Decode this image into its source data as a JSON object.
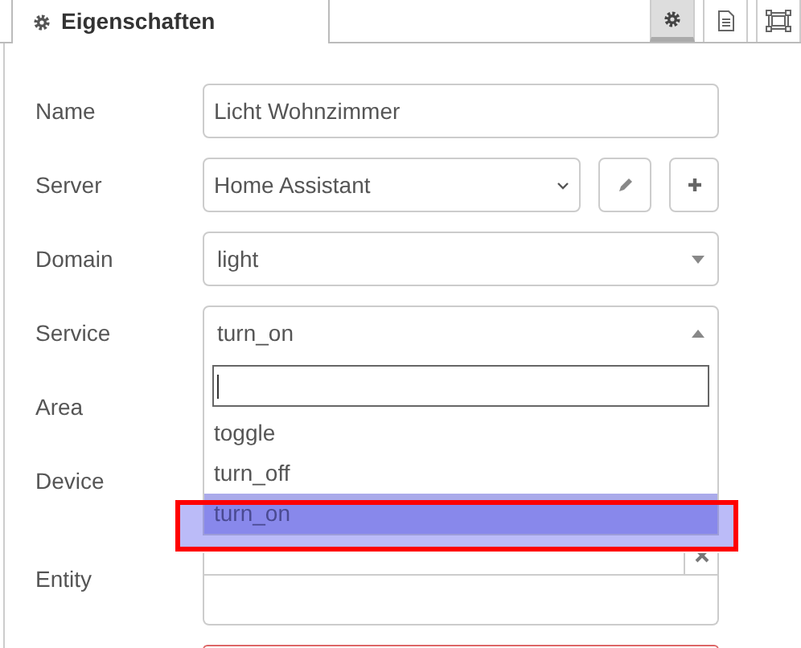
{
  "tabs": [
    {
      "label": "Eigenschaften",
      "selected": true
    }
  ],
  "toolbar": [
    {
      "kind": "settings",
      "selected": true
    },
    {
      "kind": "description",
      "selected": false
    },
    {
      "kind": "appearance",
      "selected": false
    }
  ],
  "fields": [
    {
      "label": "Name",
      "kind": "text",
      "value": "Licht Wohnzimmer"
    },
    {
      "label": "Server",
      "kind": "server",
      "value": "Home Assistant"
    },
    {
      "label": "Domain",
      "kind": "combo",
      "value": "light",
      "expanded": false
    },
    {
      "label": "Service",
      "kind": "combo",
      "value": "turn_on",
      "expanded": true
    },
    {
      "label": "Area",
      "kind": "covered"
    },
    {
      "label": "Device",
      "kind": "covered"
    },
    {
      "label": "Entity",
      "kind": "tags"
    },
    {
      "kind": "partial",
      "invalid": true
    }
  ],
  "dropdown": {
    "options": [
      {
        "label": "toggle",
        "selected": false
      },
      {
        "label": "turn_off",
        "selected": false
      },
      {
        "label": "turn_on",
        "selected": true
      }
    ]
  }
}
